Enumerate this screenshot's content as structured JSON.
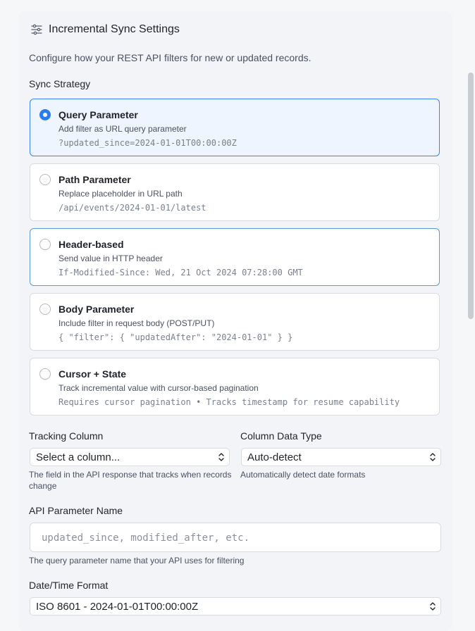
{
  "header": {
    "title": "Incremental Sync Settings",
    "icon": "sliders-icon"
  },
  "description": "Configure how your REST API filters for new or updated records.",
  "sync_strategy": {
    "label": "Sync Strategy",
    "selected": "Query Parameter",
    "options": [
      {
        "title": "Query Parameter",
        "subtitle": "Add filter as URL query parameter",
        "example": "?updated_since=2024-01-01T00:00:00Z"
      },
      {
        "title": "Path Parameter",
        "subtitle": "Replace placeholder in URL path",
        "example": "/api/events/2024-01-01/latest"
      },
      {
        "title": "Header-based",
        "subtitle": "Send value in HTTP header",
        "example": "If-Modified-Since: Wed, 21 Oct 2024 07:28:00 GMT"
      },
      {
        "title": "Body Parameter",
        "subtitle": "Include filter in request body (POST/PUT)",
        "example": "{ \"filter\": { \"updatedAfter\": \"2024-01-01\" } }"
      },
      {
        "title": "Cursor + State",
        "subtitle": "Track incremental value with cursor-based pagination",
        "example": "Requires cursor pagination • Tracks timestamp for resume capability"
      }
    ]
  },
  "tracking_column": {
    "label": "Tracking Column",
    "value": "Select a column...",
    "help": "The field in the API response that tracks when records change"
  },
  "column_data_type": {
    "label": "Column Data Type",
    "value": "Auto-detect",
    "help": "Automatically detect date formats"
  },
  "api_parameter_name": {
    "label": "API Parameter Name",
    "placeholder": "updated_since, modified_after, etc.",
    "help": "The query parameter name that your API uses for filtering"
  },
  "datetime_format": {
    "label": "Date/Time Format",
    "value": "ISO 8601 - 2024-01-01T00:00:00Z"
  },
  "colors": {
    "accent": "#2b7cf0",
    "selected_bg": "#eef5ff",
    "border": "#d8dbe0"
  }
}
